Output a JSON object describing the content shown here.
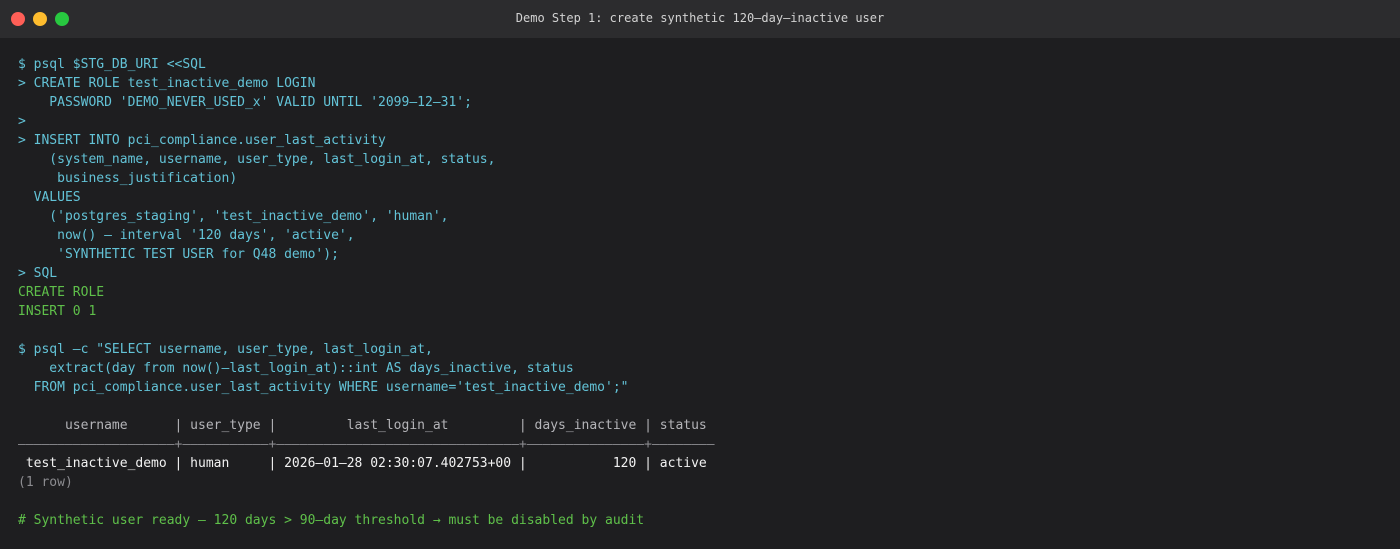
{
  "window": {
    "title": "Demo Step 1: create synthetic 120–day–inactive user"
  },
  "terminal": {
    "lines": [
      {
        "kind": "cmd",
        "text": "$ psql $STG_DB_URI <<SQL"
      },
      {
        "kind": "cmd",
        "text": "> CREATE ROLE test_inactive_demo LOGIN"
      },
      {
        "kind": "cmd",
        "text": "    PASSWORD 'DEMO_NEVER_USED_x' VALID UNTIL '2099–12–31';"
      },
      {
        "kind": "cmd",
        "text": ">"
      },
      {
        "kind": "cmd",
        "text": "> INSERT INTO pci_compliance.user_last_activity"
      },
      {
        "kind": "cmd",
        "text": "    (system_name, username, user_type, last_login_at, status,"
      },
      {
        "kind": "cmd",
        "text": "     business_justification)"
      },
      {
        "kind": "cmd",
        "text": "  VALUES"
      },
      {
        "kind": "cmd",
        "text": "    ('postgres_staging', 'test_inactive_demo', 'human',"
      },
      {
        "kind": "cmd",
        "text": "     now() – interval '120 days', 'active',"
      },
      {
        "kind": "cmd",
        "text": "     'SYNTHETIC TEST USER for Q48 demo');"
      },
      {
        "kind": "cmd",
        "text": "> SQL"
      },
      {
        "kind": "ok",
        "text": "CREATE ROLE"
      },
      {
        "kind": "ok",
        "text": "INSERT 0 1"
      },
      {
        "kind": "blank",
        "text": ""
      },
      {
        "kind": "cmd",
        "text": "$ psql –c \"SELECT username, user_type, last_login_at,"
      },
      {
        "kind": "cmd",
        "text": "    extract(day from now()–last_login_at)::int AS days_inactive, status"
      },
      {
        "kind": "cmd",
        "text": "  FROM pci_compliance.user_last_activity WHERE username='test_inactive_demo';\""
      },
      {
        "kind": "blank",
        "text": ""
      },
      {
        "kind": "hdr",
        "text": "      username      | user_type |         last_login_at         | days_inactive | status"
      },
      {
        "kind": "sep",
        "text": "––––––––––––––––––––+–––––––––––+–––––––––––––––––––––––––––––––+–––––––––––––––+––––––––"
      },
      {
        "kind": "row",
        "text": " test_inactive_demo | human     | 2026–01–28 02:30:07.402753+00 |           120 | active"
      },
      {
        "kind": "meta",
        "text": "(1 row)"
      },
      {
        "kind": "blank",
        "text": ""
      },
      {
        "kind": "note",
        "text": "# Synthetic user ready — 120 days > 90–day threshold → must be disabled by audit"
      }
    ]
  },
  "colors": {
    "command": "#63c3d7",
    "success": "#5fc04a",
    "background": "#1e1e20",
    "titlebar": "#2c2c2e"
  }
}
